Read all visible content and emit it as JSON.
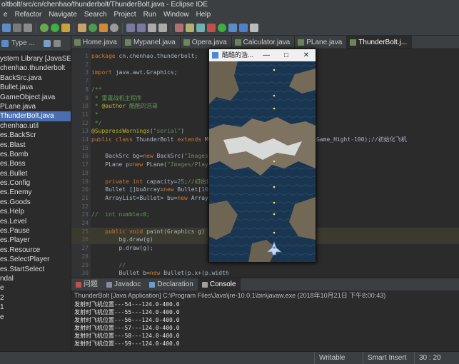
{
  "window_title": "oltbolt/src/cn/chenhao/thunderbolt/ThunderBolt.java - Eclipse IDE",
  "menu": [
    "e",
    "Refactor",
    "Navigate",
    "Search",
    "Project",
    "Run",
    "Window",
    "Help"
  ],
  "left_panel": {
    "tab_label": "Type ...",
    "items": [
      {
        "label": "ystem Library [JavaSE-",
        "suffix": ""
      },
      {
        "label": "chenhao.thunderbolt",
        "suffix": ""
      },
      {
        "label": "BackSrc.java",
        "suffix": ""
      },
      {
        "label": "Bullet.java",
        "suffix": ""
      },
      {
        "label": "GameObject.java",
        "suffix": ""
      },
      {
        "label": "PLane.java",
        "suffix": ""
      },
      {
        "label": "ThunderBolt.java",
        "suffix": ""
      },
      {
        "label": "chenhao.util",
        "suffix": ""
      },
      {
        "label": "es.BackScr",
        "suffix": ""
      },
      {
        "label": "es.Blast",
        "suffix": ""
      },
      {
        "label": "es.Bomb",
        "suffix": ""
      },
      {
        "label": "es.Boss",
        "suffix": ""
      },
      {
        "label": "es.Bullet",
        "suffix": ""
      },
      {
        "label": "es.Config",
        "suffix": ""
      },
      {
        "label": "es.Enemy",
        "suffix": ""
      },
      {
        "label": "es.Goods",
        "suffix": ""
      },
      {
        "label": "es.Help",
        "suffix": ""
      },
      {
        "label": "es.Level",
        "suffix": ""
      },
      {
        "label": "es.Pause",
        "suffix": ""
      },
      {
        "label": "es.Player",
        "suffix": ""
      },
      {
        "label": "es.Resource",
        "suffix": ""
      },
      {
        "label": "es.SelectPlayer",
        "suffix": ""
      },
      {
        "label": "es.StartSelect",
        "suffix": ""
      },
      {
        "label": "ndal",
        "suffix": ""
      },
      {
        "label": "e",
        "suffix": ""
      },
      {
        "label": "2",
        "suffix": ""
      },
      {
        "label": "1",
        "suffix": ""
      },
      {
        "label": "e",
        "suffix": ""
      }
    ],
    "selected_index": 6
  },
  "editor_tabs": [
    {
      "label": "Home.java",
      "active": false
    },
    {
      "label": "Mypanel.java",
      "active": false
    },
    {
      "label": "Opera.java",
      "active": false
    },
    {
      "label": "Calculator.java",
      "active": false
    },
    {
      "label": "PLane.java",
      "active": false
    },
    {
      "label": "ThunderBolt.j...",
      "active": true
    }
  ],
  "code_lines": [
    {
      "n": "1",
      "parts": [
        [
          "kw",
          "package "
        ],
        [
          "tx",
          "cn.chenhao.thunderbolt;"
        ]
      ]
    },
    {
      "n": "2",
      "parts": []
    },
    {
      "n": "3",
      "parts": [
        [
          "kw",
          "import "
        ],
        [
          "tx",
          "java.awt.Graphics;"
        ]
      ]
    },
    {
      "n": "7",
      "parts": []
    },
    {
      "n": "8",
      "parts": [
        [
          "cm",
          "/**"
        ]
      ]
    },
    {
      "n": "9",
      "parts": [
        [
          "cm",
          " * 雷霆战机主程序"
        ]
      ]
    },
    {
      "n": "10",
      "parts": [
        [
          "cm",
          " * "
        ],
        [
          "an",
          "@author"
        ],
        [
          "cm",
          " 酷酷的浩哥"
        ]
      ]
    },
    {
      "n": "11",
      "parts": [
        [
          "cm",
          " *"
        ]
      ]
    },
    {
      "n": "12",
      "parts": [
        [
          "cm",
          " */"
        ]
      ]
    },
    {
      "n": "13",
      "parts": [
        [
          "an",
          "@SuppressWarnings"
        ],
        [
          "tx",
          "("
        ],
        [
          "str",
          "\"serial\""
        ],
        [
          "tx",
          ")"
        ]
      ]
    },
    {
      "n": "14",
      "parts": [
        [
          "kw",
          "public class "
        ],
        [
          "tx",
          "ThunderBolt "
        ],
        [
          "kw",
          "extends "
        ],
        [
          "tx",
          "MyFrame{"
        ]
      ]
    },
    {
      "n": "15",
      "parts": []
    },
    {
      "n": "16",
      "parts": [
        [
          "tx",
          "    BackSrc bg="
        ],
        [
          "kw",
          "new "
        ],
        [
          "tx",
          "BackSrc("
        ],
        [
          "str",
          "\"Images/BackSc"
        ]
      ]
    },
    {
      "n": "17",
      "parts": [
        [
          "tx",
          "    PLane p="
        ],
        [
          "kw",
          "new "
        ],
        [
          "tx",
          "PLane("
        ],
        [
          "str",
          "\"Images/Player/icon"
        ]
      ]
    },
    {
      "n": "18",
      "parts": []
    },
    {
      "n": "19",
      "parts": [
        [
          "kw",
          "    private int "
        ],
        [
          "tx",
          "capacity="
        ],
        [
          "nm",
          "25"
        ],
        [
          "tx",
          ";"
        ],
        [
          "cm",
          "//初始化弹容量"
        ]
      ]
    },
    {
      "n": "20",
      "parts": [
        [
          "tx",
          "    Bullet []buArray="
        ],
        [
          "kw",
          "new "
        ],
        [
          "tx",
          "Bullet["
        ],
        [
          "nm",
          "1000000"
        ]
      ]
    },
    {
      "n": "21",
      "parts": [
        [
          "tx",
          "    ArrayList<Bullet> bu="
        ],
        [
          "kw",
          "new "
        ],
        [
          "tx",
          "ArrayList<Bu"
        ]
      ]
    },
    {
      "n": "22",
      "parts": []
    },
    {
      "n": "23",
      "parts": [
        [
          "cm",
          "//  int numble=0;"
        ]
      ]
    },
    {
      "n": "24",
      "parts": []
    },
    {
      "n": "25",
      "parts": [
        [
          "kw",
          "    public void "
        ],
        [
          "tx",
          "paint(Graphics g) {"
        ]
      ]
    },
    {
      "n": "26",
      "parts": [
        [
          "tx",
          "        bg.draw(g)"
        ]
      ]
    },
    {
      "n": "27",
      "parts": [
        [
          "tx",
          "        p.draw(g);"
        ]
      ]
    },
    {
      "n": "28",
      "parts": []
    },
    {
      "n": "29",
      "parts": [
        [
          "cm",
          "        //"
        ]
      ]
    },
    {
      "n": "30",
      "parts": [
        [
          "tx",
          "        Bullet b="
        ],
        [
          "kw",
          "new "
        ],
        [
          "tx",
          "Bullet(p.x+(p.width"
        ]
      ]
    },
    {
      "n": "31",
      "parts": [
        [
          "tx",
          "        bu.add(b);"
        ]
      ]
    },
    {
      "n": "32",
      "parts": [
        [
          "cm",
          "        //"
        ]
      ]
    },
    {
      "n": "33",
      "parts": [
        [
          "tx",
          "        Object[] arr=bu.toArray();"
        ]
      ]
    },
    {
      "n": "34",
      "parts": [
        [
          "kw",
          "        for"
        ],
        [
          "tx",
          "(int i="
        ],
        [
          "nm",
          "0"
        ],
        [
          "tx",
          ";i<bu.size();i++) {"
        ]
      ]
    },
    {
      "n": "35",
      "parts": [
        [
          "tx",
          "            b=arr[i]/(Bullet) arr[i]."
        ]
      ]
    }
  ],
  "code_tail": "Game_Hight-100);//初始化飞机",
  "game_window": {
    "title": "酷酷的浩..."
  },
  "bottom_tabs": [
    {
      "label": "问题",
      "active": false
    },
    {
      "label": "Javadoc",
      "active": false
    },
    {
      "label": "Declaration",
      "active": false
    },
    {
      "label": "Console",
      "active": true
    }
  ],
  "console": {
    "header": "ThunderBolt [Java Application] C:\\Program Files\\Java\\jre-10.0.1\\bin\\javaw.exe (2018年10月21日 下午8:00:43)",
    "lines": [
      "发射时飞机位置---54---124.0-400.0",
      "发射时飞机位置---55---124.0-400.0",
      "发射时飞机位置---56---124.0-400.0",
      "发射时飞机位置---57---124.0-400.0",
      "发射时飞机位置---58---124.0-400.0",
      "发射时飞机位置---59---124.0-400.0"
    ]
  },
  "status": {
    "mode": "Writable",
    "insert": "Smart Insert",
    "position": "30 : 20"
  }
}
